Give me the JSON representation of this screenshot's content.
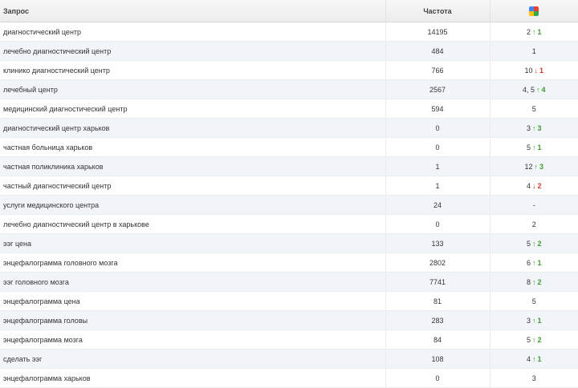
{
  "header": {
    "query_label": "Запрос",
    "frequency_label": "Частота",
    "engine_icon": "google-icon"
  },
  "colors": {
    "up": "#3f9d2b",
    "down": "#d33a2c",
    "stripe": "#f1f5fa"
  },
  "rows": [
    {
      "query": "диагностический центр",
      "frequency": "14195",
      "position": "2",
      "arrow": "↑",
      "change": "1",
      "dir": "up"
    },
    {
      "query": "лечебно диагностический центр",
      "frequency": "484",
      "position": "1",
      "arrow": "",
      "change": "",
      "dir": ""
    },
    {
      "query": "клинико диагностический центр",
      "frequency": "766",
      "position": "10",
      "arrow": "↓",
      "change": "1",
      "dir": "down"
    },
    {
      "query": "лечебный центр",
      "frequency": "2567",
      "position": "4, 5",
      "arrow": "↑",
      "change": "4",
      "dir": "up"
    },
    {
      "query": "медицинский диагностический центр",
      "frequency": "594",
      "position": "5",
      "arrow": "",
      "change": "",
      "dir": ""
    },
    {
      "query": "диагностический центр харьков",
      "frequency": "0",
      "position": "3",
      "arrow": "↑",
      "change": "3",
      "dir": "up"
    },
    {
      "query": "частная больница харьков",
      "frequency": "0",
      "position": "5",
      "arrow": "↑",
      "change": "1",
      "dir": "up"
    },
    {
      "query": "частная поликлиника харьков",
      "frequency": "1",
      "position": "12",
      "arrow": "↑",
      "change": "3",
      "dir": "up"
    },
    {
      "query": "частный диагностический центр",
      "frequency": "1",
      "position": "4",
      "arrow": "↓",
      "change": "2",
      "dir": "down"
    },
    {
      "query": "услуги медицинского центра",
      "frequency": "24",
      "position": "-",
      "arrow": "",
      "change": "",
      "dir": ""
    },
    {
      "query": "лечебно диагностический центр в харькове",
      "frequency": "0",
      "position": "2",
      "arrow": "",
      "change": "",
      "dir": ""
    },
    {
      "query": "ээг цена",
      "frequency": "133",
      "position": "5",
      "arrow": "↑",
      "change": "2",
      "dir": "up"
    },
    {
      "query": "энцефалограмма головного мозга",
      "frequency": "2802",
      "position": "6",
      "arrow": "↑",
      "change": "1",
      "dir": "up"
    },
    {
      "query": "ээг головного мозга",
      "frequency": "7741",
      "position": "8",
      "arrow": "↑",
      "change": "2",
      "dir": "up"
    },
    {
      "query": "энцефалограмма цена",
      "frequency": "81",
      "position": "5",
      "arrow": "",
      "change": "",
      "dir": ""
    },
    {
      "query": "энцефалограмма головы",
      "frequency": "283",
      "position": "3",
      "arrow": "↑",
      "change": "1",
      "dir": "up"
    },
    {
      "query": "энцефалограмма мозга",
      "frequency": "84",
      "position": "5",
      "arrow": "↑",
      "change": "2",
      "dir": "up"
    },
    {
      "query": "сделать ээг",
      "frequency": "108",
      "position": "4",
      "arrow": "↑",
      "change": "1",
      "dir": "up"
    },
    {
      "query": "энцефалограмма харьков",
      "frequency": "0",
      "position": "3",
      "arrow": "",
      "change": "",
      "dir": ""
    }
  ]
}
